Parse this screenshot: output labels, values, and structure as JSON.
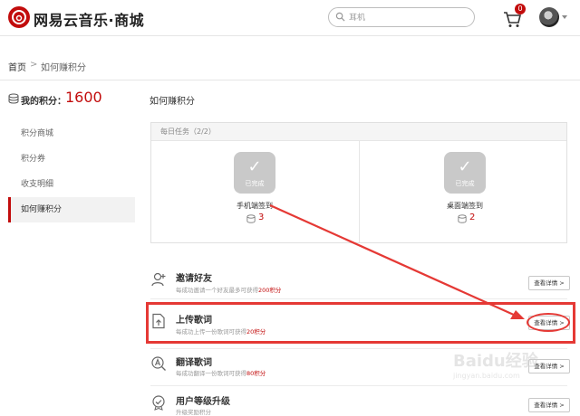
{
  "header": {
    "logo_text": "网易云音乐·商城",
    "search_placeholder": "耳机",
    "cart_count": "0"
  },
  "breadcrumb": {
    "home": "首页",
    "separator": ">",
    "current": "如何赚积分"
  },
  "sidebar": {
    "points_label": "我的积分：",
    "points_value": "1600",
    "items": [
      {
        "label": "积分商城"
      },
      {
        "label": "积分券"
      },
      {
        "label": "收支明细"
      },
      {
        "label": "如何赚积分",
        "active": true
      }
    ]
  },
  "main": {
    "title": "如何赚积分",
    "daily": {
      "header": "每日任务（2/2）",
      "tasks": [
        {
          "name": "手机端签到",
          "status": "已完成",
          "reward": "3"
        },
        {
          "name": "桌面端签到",
          "status": "已完成",
          "reward": "2"
        }
      ]
    },
    "rows": [
      {
        "title": "邀请好友",
        "desc_prefix": "每成功邀请一个好友最多可获得",
        "desc_highlight": "200积分",
        "button": "查看详情 >",
        "icon": "add-user-icon"
      },
      {
        "title": "上传歌词",
        "desc_prefix": "每成功上传一份歌词可获得",
        "desc_highlight": "20积分",
        "button": "查看详情 >",
        "icon": "upload-icon"
      },
      {
        "title": "翻译歌词",
        "desc_prefix": "每成功翻译一份歌词可获得",
        "desc_highlight": "80积分",
        "button": "查看详情 >",
        "icon": "translate-icon"
      },
      {
        "title": "用户等级升级",
        "desc_prefix": "升级奖励积分",
        "desc_highlight": "",
        "button": "查看详情 >",
        "icon": "level-badge-icon"
      }
    ]
  },
  "watermark": {
    "text": "Baidu经验",
    "sub": "jingyan.baidu.com"
  },
  "colors": {
    "brand": "#c20c0c",
    "annotation": "#e53935"
  }
}
